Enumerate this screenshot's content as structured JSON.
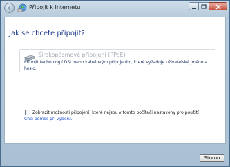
{
  "window": {
    "title": "Připojit k Internetu"
  },
  "main": {
    "heading": "Jak se chcete připojit?",
    "option": {
      "title": "Širokopásmové připojení (PPoE)",
      "description": "Připojit technologií DSL nebo kabelovým připojením, které vyžaduje uživatelské jméno a heslo.",
      "icon": "broadband-modem-icon"
    },
    "checkbox": {
      "label": "Zobrazit možnosti připojení, které nejsou v tomto počítači nastaveny pro použití",
      "checked": false
    },
    "help_link": "Chci pomoc při výběru."
  },
  "footer": {
    "cancel_label": "Storno"
  }
}
